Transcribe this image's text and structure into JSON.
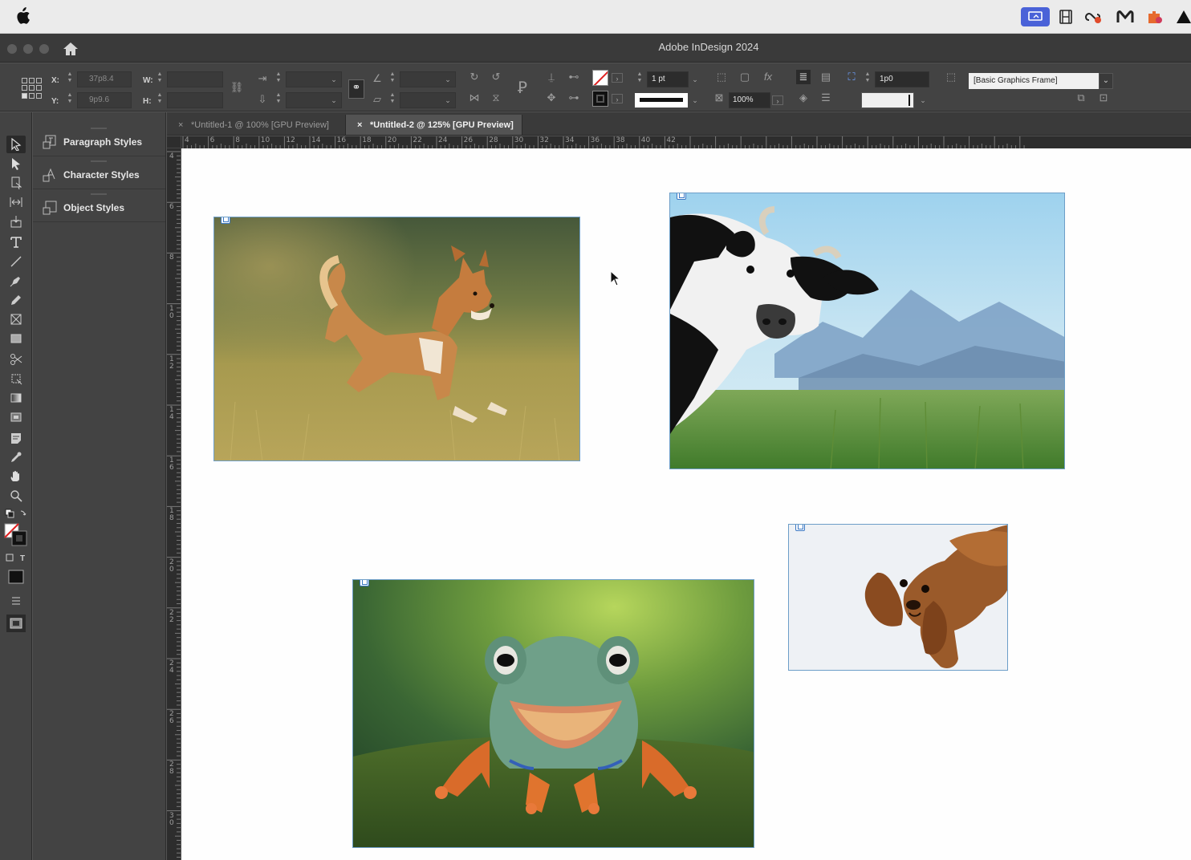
{
  "menubar": {
    "icons": [
      "apple-logo",
      "screen-mirror-icon",
      "film-strip-icon",
      "creative-cloud-icon",
      "malwarebytes-icon",
      "puzzle-extension-icon",
      "drive-icon"
    ]
  },
  "window": {
    "title": "Adobe InDesign 2024"
  },
  "control_panel": {
    "x_label": "X:",
    "x_value": "37p8.4",
    "y_label": "Y:",
    "y_value": "9p9.6",
    "w_label": "W:",
    "w_value": "",
    "h_label": "H:",
    "h_value": "",
    "stroke_weight": "1 pt",
    "scale_percent": "100%",
    "gap_value": "1p0",
    "object_style": "[Basic Graphics Frame]"
  },
  "panel": {
    "items": [
      {
        "label": "Paragraph Styles"
      },
      {
        "label": "Character Styles"
      },
      {
        "label": "Object Styles"
      }
    ]
  },
  "tabs": [
    {
      "close": "×",
      "label": "*Untitled-1 @ 100% [GPU Preview]",
      "active": false
    },
    {
      "close": "×",
      "label": "*Untitled-2 @ 125% [GPU Preview]",
      "active": true
    }
  ],
  "rulers": {
    "horizontal": [
      "4",
      "6",
      "8",
      "10",
      "12",
      "14",
      "16",
      "18",
      "20",
      "22",
      "24",
      "26",
      "28",
      "30",
      "32",
      "34",
      "36",
      "38",
      "40",
      "42"
    ],
    "vertical": [
      "4",
      "6",
      "8",
      "10",
      "12",
      "14",
      "16",
      "18",
      "20",
      "22",
      "24",
      "26",
      "28",
      "30"
    ]
  },
  "images": [
    {
      "name": "corgi-running-image"
    },
    {
      "name": "cow-meadow-image"
    },
    {
      "name": "cocker-spaniel-image"
    },
    {
      "name": "green-frog-image"
    }
  ],
  "colors": {
    "app_dark": "#535353",
    "panel": "#434343",
    "frame_border": "#6d9ec8",
    "accent_blue": "#3b78c4"
  }
}
